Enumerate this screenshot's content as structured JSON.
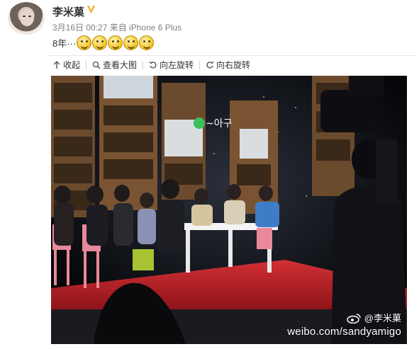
{
  "post": {
    "username": "李米菓",
    "meta": "3月16日 00:27 来自 iPhone 6 Plus",
    "text": "8年···",
    "emojis": [
      "grin-icon",
      "laugh-icon",
      "big-laugh-icon",
      "smile-icon",
      "yummy-icon"
    ]
  },
  "toolbar": {
    "collapse": "收起",
    "view_large": "查看大图",
    "rotate_left": "向左旋转",
    "rotate_right": "向右旋转"
  },
  "photo": {
    "stage_sign": "~아구",
    "watermark_handle": "@李米菓",
    "watermark_url": "weibo.com/sandyamigo"
  },
  "colors": {
    "accent": "#f5a623",
    "stage_floor": "#c8202a",
    "chair_pink": "#e8889a"
  }
}
